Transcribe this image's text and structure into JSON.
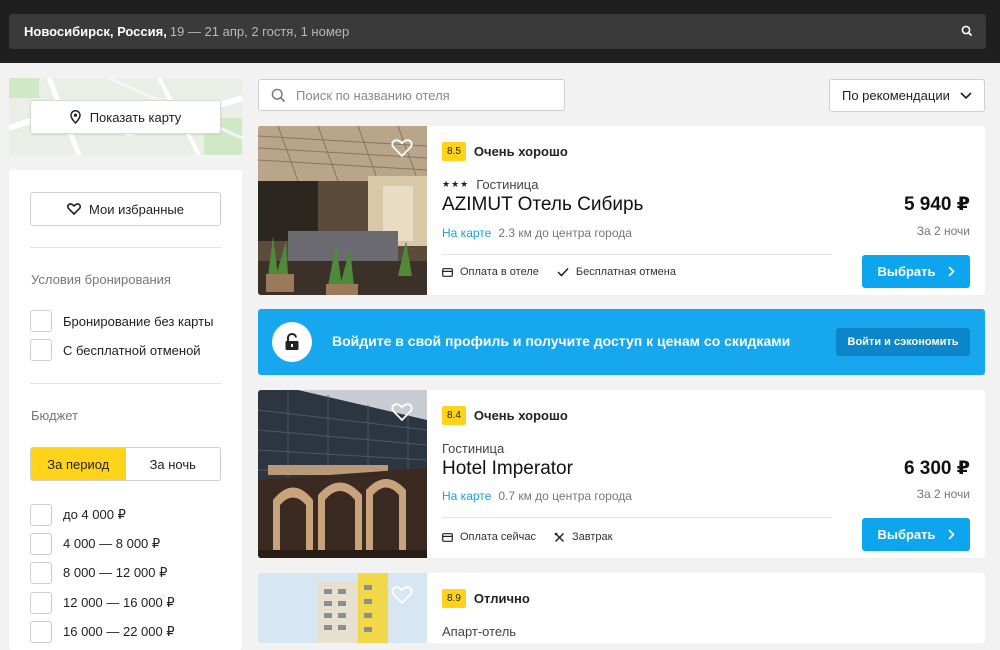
{
  "search": {
    "city": "Новосибирск, Россия,",
    "details": "19 — 21 апр, 2 гостя, 1 номер"
  },
  "sidebar": {
    "map_button": "Показать карту",
    "favorites_button": "Мои избранные",
    "booking_title": "Условия бронирования",
    "booking_options": [
      "Бронирование без карты",
      "С бесплатной отменой"
    ],
    "budget_title": "Бюджет",
    "budget_toggle": {
      "period": "За период",
      "night": "За ночь"
    },
    "budget_ranges": [
      "до 4 000 ₽",
      "4 000 — 8 000 ₽",
      "8 000 — 12 000 ₽",
      "12 000 — 16 000 ₽",
      "16 000 — 22 000 ₽"
    ]
  },
  "toolbar": {
    "hotel_search_placeholder": "Поиск по названию отеля",
    "sort_value": "По рекомендации"
  },
  "hotels": [
    {
      "score": "8.5",
      "rating_label": "Очень хорошо",
      "stars": "★★★",
      "type": "Гостиница",
      "name": "AZIMUT Отель Сибирь",
      "on_map": "На карте",
      "distance": "2.3 км до центра города",
      "amenities": [
        "Оплата в отеле",
        "Бесплатная отмена"
      ],
      "price": "5 940 ₽",
      "nights": "За 2 ночи",
      "choose": "Выбрать"
    },
    {
      "score": "8.4",
      "rating_label": "Очень хорошо",
      "type": "Гостиница",
      "name": "Hotel Imperator",
      "on_map": "На карте",
      "distance": "0.7 км до центра города",
      "amenities": [
        "Оплата сейчас",
        "Завтрак"
      ],
      "price": "6 300 ₽",
      "nights": "За 2 ночи",
      "choose": "Выбрать"
    },
    {
      "score": "8.9",
      "rating_label": "Отлично",
      "type": "Апарт-отель"
    }
  ],
  "promo": {
    "text": "Войдите в свой профиль и получите доступ к ценам со скидками",
    "button": "Войти и сэкономить"
  },
  "colors": {
    "accent_blue": "#0ea5ef",
    "rating_yellow": "#ffd31a",
    "topbar": "#1f1f1f"
  }
}
